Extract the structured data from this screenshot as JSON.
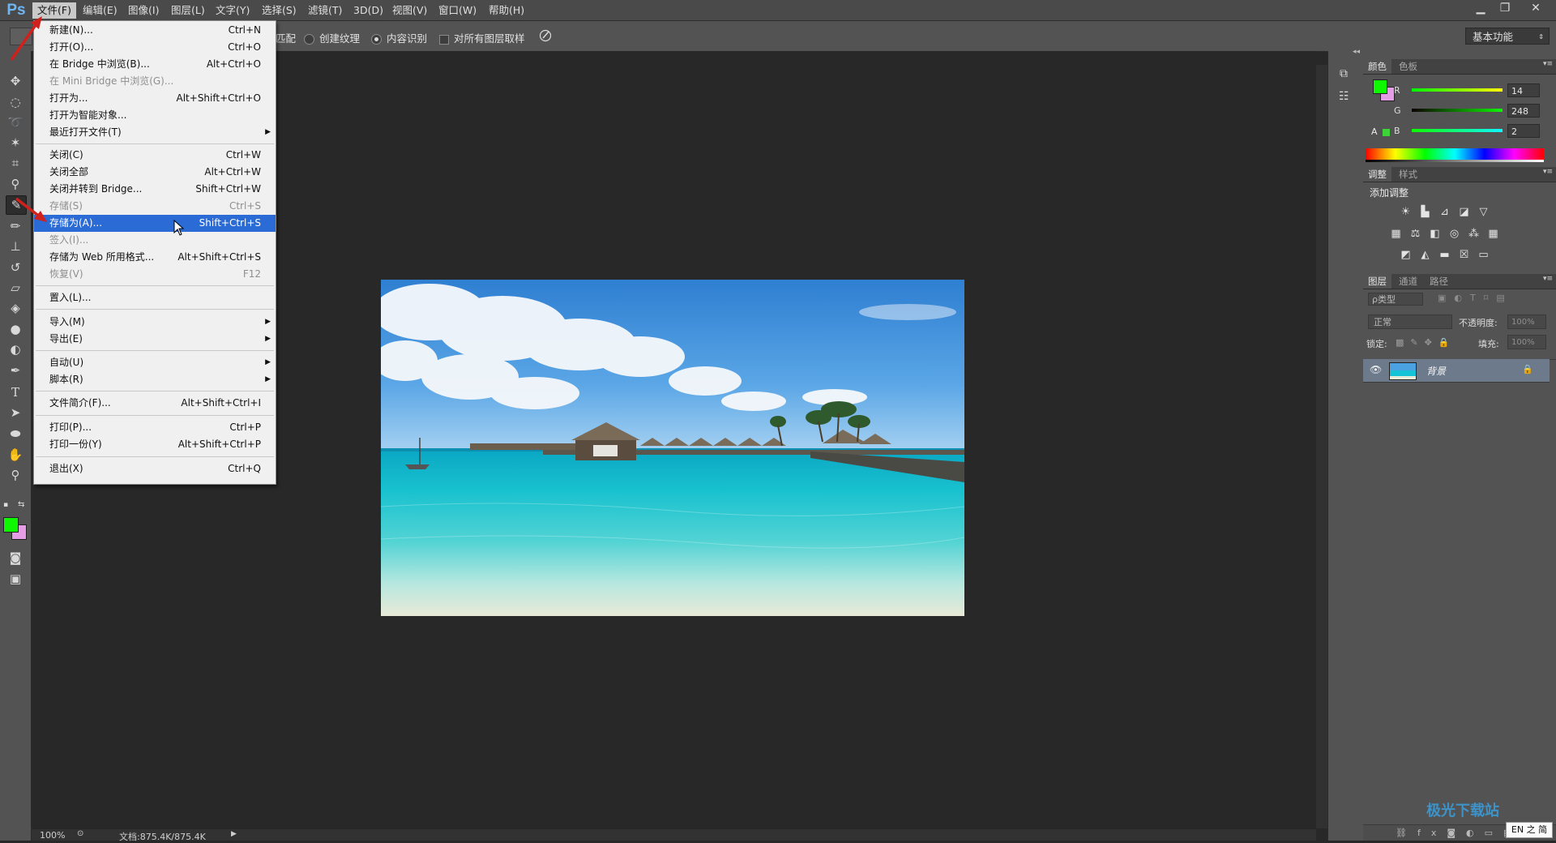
{
  "app": {
    "logo": "Ps"
  },
  "menubar": {
    "items": [
      "文件(F)",
      "编辑(E)",
      "图像(I)",
      "图层(L)",
      "文字(Y)",
      "选择(S)",
      "滤镜(T)",
      "3D(D)",
      "视图(V)",
      "窗口(W)",
      "帮助(H)"
    ]
  },
  "window_controls": {
    "minimize": "▁",
    "restore": "❐",
    "close": "✕"
  },
  "options_bar": {
    "partial_label": "匹配",
    "radio1": "创建纹理",
    "radio2": "内容识别",
    "checkbox": "对所有图层取样",
    "workspace": "基本功能"
  },
  "file_menu": {
    "items": [
      {
        "label": "新建(N)...",
        "shortcut": "Ctrl+N"
      },
      {
        "label": "打开(O)...",
        "shortcut": "Ctrl+O"
      },
      {
        "label": "在 Bridge 中浏览(B)...",
        "shortcut": "Alt+Ctrl+O"
      },
      {
        "label": "在 Mini Bridge 中浏览(G)...",
        "shortcut": ""
      },
      {
        "label": "打开为...",
        "shortcut": "Alt+Shift+Ctrl+O"
      },
      {
        "label": "打开为智能对象...",
        "shortcut": ""
      },
      {
        "label": "最近打开文件(T)",
        "shortcut": ""
      },
      {
        "label": "关闭(C)",
        "shortcut": "Ctrl+W"
      },
      {
        "label": "关闭全部",
        "shortcut": "Alt+Ctrl+W"
      },
      {
        "label": "关闭并转到 Bridge...",
        "shortcut": "Shift+Ctrl+W"
      },
      {
        "label": "存储(S)",
        "shortcut": "Ctrl+S"
      },
      {
        "label": "存储为(A)...",
        "shortcut": "Shift+Ctrl+S"
      },
      {
        "label": "签入(I)...",
        "shortcut": ""
      },
      {
        "label": "存储为 Web 所用格式...",
        "shortcut": "Alt+Shift+Ctrl+S"
      },
      {
        "label": "恢复(V)",
        "shortcut": "F12"
      },
      {
        "label": "置入(L)...",
        "shortcut": ""
      },
      {
        "label": "导入(M)",
        "shortcut": ""
      },
      {
        "label": "导出(E)",
        "shortcut": ""
      },
      {
        "label": "自动(U)",
        "shortcut": ""
      },
      {
        "label": "脚本(R)",
        "shortcut": ""
      },
      {
        "label": "文件简介(F)...",
        "shortcut": "Alt+Shift+Ctrl+I"
      },
      {
        "label": "打印(P)...",
        "shortcut": "Ctrl+P"
      },
      {
        "label": "打印一份(Y)",
        "shortcut": "Alt+Shift+Ctrl+P"
      },
      {
        "label": "退出(X)",
        "shortcut": "Ctrl+Q"
      }
    ]
  },
  "color_panel": {
    "tabs": [
      "颜色",
      "色板"
    ],
    "r_label": "R",
    "g_label": "G",
    "b_label": "B",
    "r": "14",
    "g": "248",
    "b": "2",
    "foreground": "#0ef802",
    "background": "#e59ee6"
  },
  "adjust_panel": {
    "tabs": [
      "调整",
      "样式"
    ],
    "title": "添加调整"
  },
  "layers_panel": {
    "tabs": [
      "图层",
      "通道",
      "路径"
    ],
    "kind": "ρ类型",
    "blend": "正常",
    "opacity_label": "不透明度:",
    "opacity": "100%",
    "lock_label": "锁定:",
    "fill_label": "填充:",
    "fill": "100%",
    "layer_name": "背景"
  },
  "status": {
    "zoom": "100%",
    "doc": "文档:875.4K/875.4K"
  },
  "watermark": {
    "site": "极光下载站",
    "lang": "EN 之 简"
  }
}
